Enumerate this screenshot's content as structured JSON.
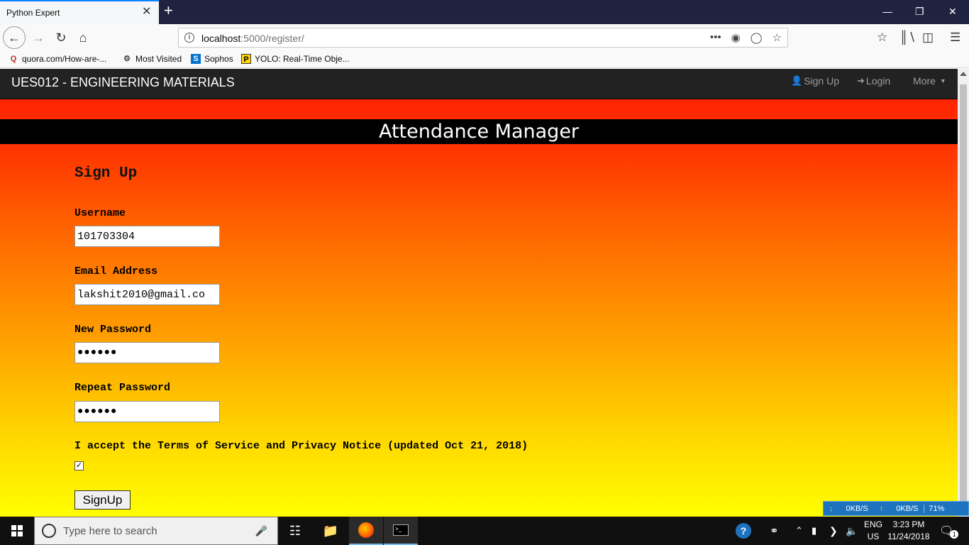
{
  "browser": {
    "tab_title": "Python Expert",
    "tab_close": "✕",
    "new_tab": "+",
    "url_host": "localhost",
    "url_rest": ":5000/register/",
    "url_actions": "•••",
    "bookmarks": [
      {
        "icon": "Q",
        "label": "quora.com/How-are-..."
      },
      {
        "icon": "⚙",
        "label": "Most Visited"
      },
      {
        "icon": "S",
        "label": "Sophos"
      },
      {
        "icon": "P",
        "label": "YOLO: Real-Time Obje..."
      }
    ]
  },
  "site": {
    "brand": "UES012 - ENGINEERING MATERIALS",
    "nav": {
      "signup": "Sign Up",
      "login": "Login",
      "more": "More"
    },
    "banner": "Attendance Manager"
  },
  "form": {
    "heading": "Sign Up",
    "username_label": "Username",
    "username_value": "101703304",
    "email_label": "Email Address",
    "email_value": "lakshit2010@gmail.co",
    "password_label": "New Password",
    "password_value": "●●●●●●",
    "repeat_label": "Repeat Password",
    "repeat_value": "●●●●●●",
    "terms_label": "I accept the Terms of Service and Privacy Notice (updated Oct 21, 2018)",
    "terms_checked": true,
    "submit_label": "SignUp"
  },
  "netspeed": {
    "down": "0KB/S",
    "up": "0KB/S",
    "percent": "71%"
  },
  "taskbar": {
    "search_placeholder": "Type here to search",
    "lang_1": "ENG",
    "lang_2": "US",
    "time": "3:23 PM",
    "date": "11/24/2018",
    "notification_count": "1"
  },
  "colors": {
    "tab_accent": "#0a84ff",
    "navbar_bg": "#222222",
    "banner_bg": "#000000",
    "gradient_top": "#ff1a00",
    "gradient_bottom": "#ffff00"
  }
}
